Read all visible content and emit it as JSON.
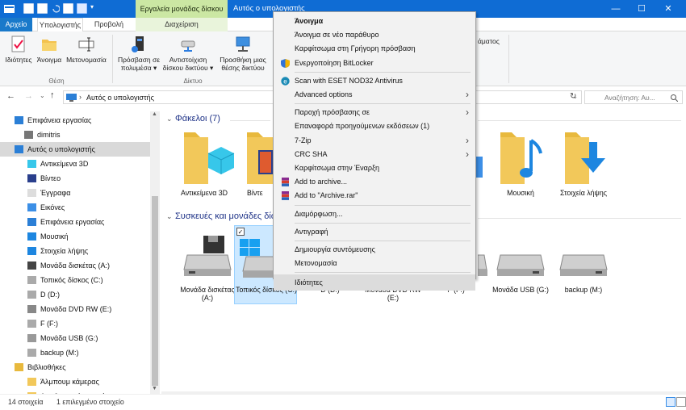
{
  "titlebar": {
    "contextual_tab": "Εργαλεία μονάδας δίσκου",
    "title": "Αυτός ο υπολογιστής",
    "minimize": "—",
    "maximize": "☐",
    "close": "✕"
  },
  "tabs": {
    "file": "Αρχείο",
    "computer": "Υπολογιστής",
    "view": "Προβολή",
    "manage": "Διαχείριση"
  },
  "ribbon": {
    "properties": "Ιδιότητες",
    "open": "Άνοιγμα",
    "rename": "Μετονομασία",
    "group_location": "Θέση",
    "media_access_1": "Πρόσβαση σε",
    "media_access_2": "πολυμέσα",
    "map_drive_1": "Αντιστοίχιση",
    "map_drive_2": "δίσκου δικτύου",
    "add_location_1": "Προσθήκη μιας",
    "add_location_2": "θέσης δικτύου",
    "group_network": "Δίκτυο",
    "right_partial": "άματος"
  },
  "address": {
    "path": "Αυτός ο υπολογιστής",
    "search_placeholder": "Αναζήτηση: Αυ..."
  },
  "nav": {
    "items": [
      {
        "label": "Επιφάνεια εργασίας",
        "icon": "desktop-icon"
      },
      {
        "label": "dimitris",
        "icon": "user-icon"
      },
      {
        "label": "Αυτός ο υπολογιστής",
        "icon": "computer-icon"
      },
      {
        "label": "Αντικείμενα 3D",
        "icon": "objects-3d-icon"
      },
      {
        "label": "Βίντεο",
        "icon": "video-icon"
      },
      {
        "label": "Έγγραφα",
        "icon": "documents-icon"
      },
      {
        "label": "Εικόνες",
        "icon": "pictures-icon"
      },
      {
        "label": "Επιφάνεια εργασίας",
        "icon": "desktop-icon"
      },
      {
        "label": "Μουσική",
        "icon": "music-icon"
      },
      {
        "label": "Στοιχεία λήψης",
        "icon": "downloads-icon"
      },
      {
        "label": "Μονάδα δισκέτας (A:)",
        "icon": "floppy-icon"
      },
      {
        "label": "Τοπικός δίσκος (C:)",
        "icon": "drive-icon"
      },
      {
        "label": "D (D:)",
        "icon": "drive-icon"
      },
      {
        "label": "Μονάδα DVD RW (E:)",
        "icon": "dvd-icon"
      },
      {
        "label": "F (F:)",
        "icon": "drive-icon"
      },
      {
        "label": "Μονάδα USB (G:)",
        "icon": "usb-icon"
      },
      {
        "label": "backup (M:)",
        "icon": "drive-icon"
      },
      {
        "label": "Βιβλιοθήκες",
        "icon": "libraries-icon"
      },
      {
        "label": "Άλμπουμ κάμερας",
        "icon": "camera-roll-icon"
      },
      {
        "label": "Αποθηκευμένες εικόνες",
        "icon": "saved-pictures-icon"
      }
    ]
  },
  "content": {
    "folders_header": "Φάκελοι (7)",
    "devices_header": "Συσκευές και μονάδες δίσ",
    "folders": [
      {
        "label": "Αντικείμενα 3D"
      },
      {
        "label": "Βίντε"
      },
      {
        "label": "Μουσική"
      },
      {
        "label": "Στοιχεία λήψης"
      }
    ],
    "drives": [
      {
        "label": "Μονάδα δισκέτας (A:)"
      },
      {
        "label": "Τοπικός δίσκος (C:)"
      },
      {
        "label": "D (D:)"
      },
      {
        "label": "Μονάδα DVD RW (E:)"
      },
      {
        "label": "F (F:)"
      },
      {
        "label": "Μονάδα USB (G:)"
      },
      {
        "label": "backup (M:)"
      }
    ]
  },
  "status": {
    "items_count": "14 στοιχεία",
    "selected": "1 επιλεγμένο στοιχείο"
  },
  "context_menu": {
    "items": [
      {
        "label": "Άνοιγμα",
        "bold": true
      },
      {
        "label": "Άνοιγμα σε νέο παράθυρο"
      },
      {
        "label": "Καρφίτσωμα στη Γρήγορη πρόσβαση"
      },
      {
        "label": "Ενεργοποίηση BitLocker",
        "icon": "bitlocker-shield-icon"
      },
      {
        "sep": true
      },
      {
        "label": "Scan with ESET NOD32 Antivirus",
        "icon": "eset-icon"
      },
      {
        "label": "Advanced options",
        "submenu": true
      },
      {
        "sep": true
      },
      {
        "label": "Παροχή πρόσβασης σε",
        "submenu": true
      },
      {
        "label": "Επαναφορά προηγούμενων εκδόσεων (1)"
      },
      {
        "label": "7-Zip",
        "submenu": true
      },
      {
        "label": "CRC SHA",
        "submenu": true
      },
      {
        "label": "Καρφίτσωμα στην Έναρξη"
      },
      {
        "label": "Add to archive...",
        "icon": "winrar-icon"
      },
      {
        "label": "Add to \"Archive.rar\"",
        "icon": "winrar-icon"
      },
      {
        "sep": true
      },
      {
        "label": "Διαμόρφωση..."
      },
      {
        "sep": true
      },
      {
        "label": "Αντιγραφή"
      },
      {
        "sep": true
      },
      {
        "label": "Δημιουργία συντόμευσης"
      },
      {
        "label": "Μετονομασία"
      },
      {
        "sep": true
      },
      {
        "label": "Ιδιότητες",
        "highlight": true
      }
    ]
  }
}
